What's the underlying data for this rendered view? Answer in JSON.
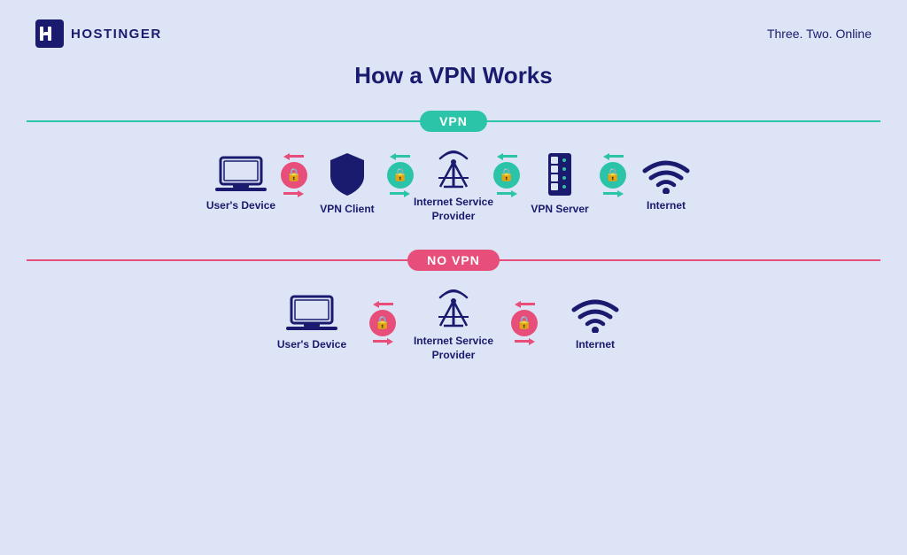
{
  "header": {
    "logo_text": "HOSTINGER",
    "tagline": "Three. Two. Online"
  },
  "main_title": "How a VPN Works",
  "vpn_section": {
    "label": "VPN",
    "nodes": [
      {
        "id": "users-device-vpn",
        "label": "User's Device"
      },
      {
        "id": "vpn-client",
        "label": "VPN Client"
      },
      {
        "id": "isp-vpn",
        "label": "Internet Service\nProvider"
      },
      {
        "id": "vpn-server",
        "label": "VPN Server"
      },
      {
        "id": "internet-vpn",
        "label": "Internet"
      }
    ],
    "arrow1_color": "red",
    "arrow2_color": "green",
    "arrow3_color": "green",
    "arrow4_color": "green"
  },
  "novpn_section": {
    "label": "NO VPN",
    "nodes": [
      {
        "id": "users-device-novpn",
        "label": "User's Device"
      },
      {
        "id": "isp-novpn",
        "label": "Internet Service\nProvider"
      },
      {
        "id": "internet-novpn",
        "label": "Internet"
      }
    ],
    "arrow1_color": "red",
    "arrow2_color": "red"
  }
}
